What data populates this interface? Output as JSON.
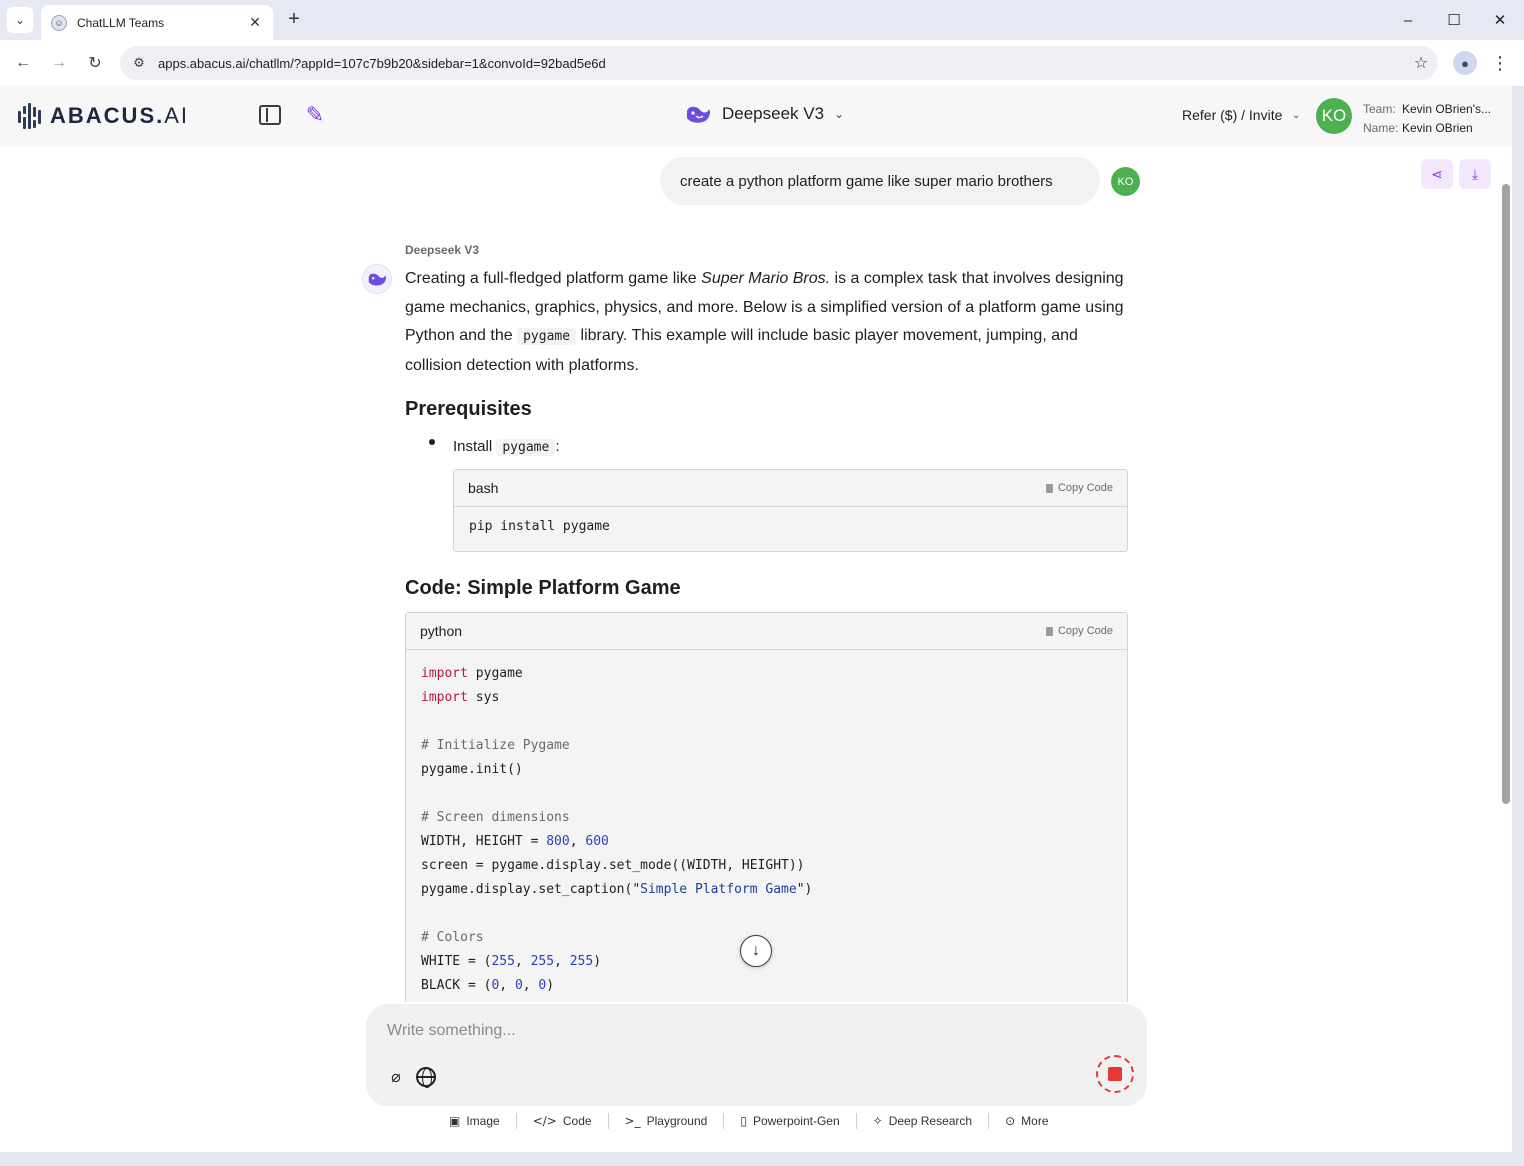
{
  "browser": {
    "tab_title": "ChatLLM Teams",
    "url": "apps.abacus.ai/chatllm/?appId=107c7b9b20&sidebar=1&convoId=92bad5e6d"
  },
  "header": {
    "logo_text_main": "ABACUS.",
    "logo_text_ai": "AI",
    "model_name": "Deepseek V3",
    "refer_label": "Refer ($) / Invite",
    "avatar_initials": "KO",
    "team_label": "Team:",
    "team_value": "Kevin OBrien's...",
    "name_label": "Name:",
    "name_value": "Kevin OBrien"
  },
  "conversation": {
    "user_message": "create a python platform game like super mario brothers",
    "user_initials": "KO",
    "bot_name": "Deepseek V3",
    "intro_a": "Creating a full-fledged platform game like ",
    "intro_italic": "Super Mario Bros.",
    "intro_b": " is a complex task that involves designing game mechanics, graphics, physics, and more. Below is a simplified version of a platform game using Python and the ",
    "intro_code": "pygame",
    "intro_c": " library. This example will include basic player movement, jumping, and collision detection with platforms.",
    "prereq_heading": "Prerequisites",
    "bullet_text_a": "Install ",
    "bullet_code": "pygame",
    "bullet_text_b": ":",
    "bash_block": {
      "lang": "bash",
      "copy_label": "Copy Code",
      "line": "pip install pygame"
    },
    "code_heading": "Code: Simple Platform Game",
    "python_block": {
      "lang": "python",
      "copy_label": "Copy Code",
      "l1_kw": "import",
      "l1_rest": " pygame",
      "l2_kw": "import",
      "l2_rest": " sys",
      "l4": "# Initialize Pygame",
      "l5": "pygame.init()",
      "l7": "# Screen dimensions",
      "l8_a": "WIDTH, HEIGHT = ",
      "l8_n1": "800",
      "l8_b": ", ",
      "l8_n2": "600",
      "l9": "screen = pygame.display.set_mode((WIDTH, HEIGHT))",
      "l10_a": "pygame.display.set_caption(\"",
      "l10_s": "Simple Platform Game",
      "l10_b": "\")",
      "l12": "# Colors",
      "l13_a": "WHITE = (",
      "l13_n1": "255",
      "l13_n2": "255",
      "l13_n3": "255",
      "l13_b": ")",
      "l14_a": "BLACK = (",
      "l14_n1": "0",
      "l14_n2": "0",
      "l14_n3": "0",
      "l14_b": ")"
    }
  },
  "composer": {
    "placeholder": "Write something..."
  },
  "tools": [
    "Image",
    "Code",
    "Playground",
    "Powerpoint-Gen",
    "Deep Research",
    "More"
  ],
  "colors": {
    "accent": "#7c3aed",
    "avatar": "#4caf50",
    "stop": "#e53935"
  }
}
